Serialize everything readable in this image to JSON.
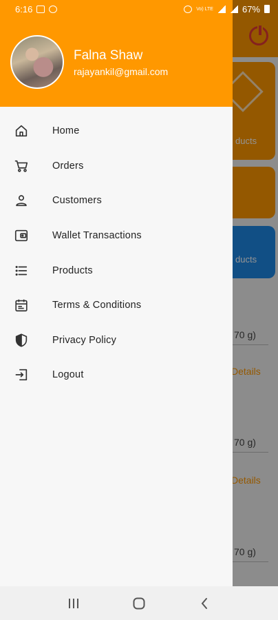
{
  "status_bar": {
    "time": "6:16",
    "network_label": "Vo) LTE",
    "battery": "67%"
  },
  "profile": {
    "name": "Falna Shaw",
    "email": "rajayankil@gmail.com"
  },
  "menu": {
    "items": [
      {
        "label": "Home",
        "icon": "home-icon"
      },
      {
        "label": "Orders",
        "icon": "cart-icon"
      },
      {
        "label": "Customers",
        "icon": "person-icon"
      },
      {
        "label": "Wallet Transactions",
        "icon": "wallet-icon"
      },
      {
        "label": "Products",
        "icon": "list-icon"
      },
      {
        "label": "Terms & Conditions",
        "icon": "calendar-icon"
      },
      {
        "label": "Privacy Policy",
        "icon": "shield-icon"
      },
      {
        "label": "Logout",
        "icon": "logout-icon"
      }
    ]
  },
  "background": {
    "card1_label": "ducts",
    "card3_label": "ducts",
    "weight_text": "70 g)",
    "details_link": "Details"
  },
  "colors": {
    "accent": "#ff9800",
    "blue": "#1e88e5",
    "power": "#e53935"
  }
}
